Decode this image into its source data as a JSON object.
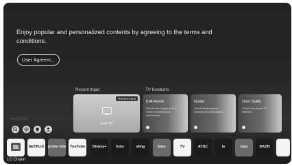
{
  "hero": {
    "message": "Enjoy popular and personalized contents by agreeing to the terms and conditions.",
    "agree_button": "User Agreem..."
  },
  "sections": {
    "recent_input": "Recent Input",
    "tv_functions": "TV functions"
  },
  "recent_card": {
    "tag": "Recent Input",
    "label": "Live TV"
  },
  "function_cards": [
    {
      "title": "Edit Home",
      "desc": "Edit the list of apps on the Home to include your preferences."
    },
    {
      "title": "Guide",
      "desc": "Check the broadcast schedule and information."
    },
    {
      "title": "User Guide",
      "desc": "Check how to use TV features."
    }
  ],
  "brand_faint": "webOS",
  "quick_icons": [
    "search-icon",
    "settings-icon",
    "notifications-icon",
    "profile-icon"
  ],
  "apps": [
    {
      "name": "lg-channels",
      "text": "",
      "style": "light"
    },
    {
      "name": "netflix",
      "text": "NETFLIX",
      "style": "light"
    },
    {
      "name": "prime-video",
      "text": "prime video",
      "style": "mid"
    },
    {
      "name": "youtube",
      "text": "YouTube",
      "style": "light"
    },
    {
      "name": "disney-plus",
      "text": "Disney+",
      "style": "dark"
    },
    {
      "name": "hulu",
      "text": "hulu",
      "style": "dark"
    },
    {
      "name": "sling",
      "text": "sling",
      "style": "dark"
    },
    {
      "name": "fubo",
      "text": "fubo",
      "style": "mid"
    },
    {
      "name": "youtube-tv",
      "text": "TV",
      "style": "light"
    },
    {
      "name": "atsc",
      "text": "ATSC",
      "style": "dark"
    },
    {
      "name": "apple-tv",
      "text": "tv",
      "style": "dark"
    },
    {
      "name": "max",
      "text": "max",
      "style": "mid"
    },
    {
      "name": "dazn",
      "text": "DAZN",
      "style": "dark"
    },
    {
      "name": "more",
      "text": "",
      "style": "light"
    }
  ],
  "app_caption": "LG Chann"
}
